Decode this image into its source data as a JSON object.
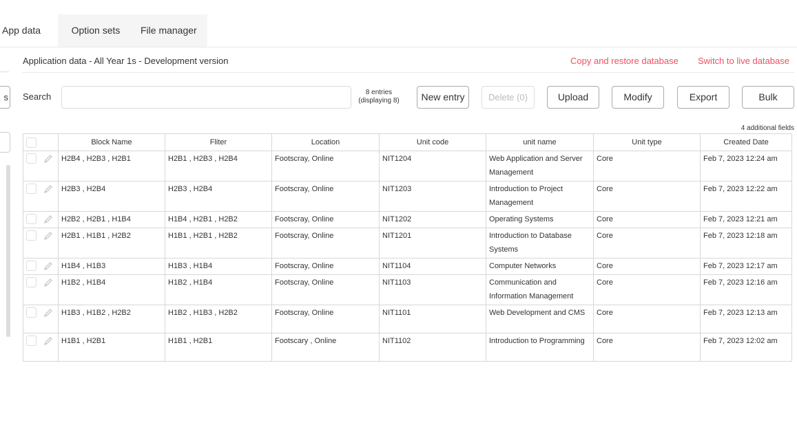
{
  "tabs": [
    {
      "label": "App data",
      "active": true
    },
    {
      "label": "Option sets",
      "active": false
    },
    {
      "label": "File manager",
      "active": false
    }
  ],
  "left_cut": {
    "button_fragment": "s"
  },
  "header": {
    "title": "Application data - All Year 1s - Development version",
    "copy_restore": "Copy and restore database",
    "switch_live": "Switch to live database"
  },
  "toolbar": {
    "search_label": "Search",
    "search_placeholder": "",
    "entries_line1": "8 entries",
    "entries_line2": "(displaying 8)",
    "new_entry": "New entry",
    "delete": "Delete (0)",
    "upload": "Upload",
    "modify": "Modify",
    "export": "Export",
    "bulk": "Bulk"
  },
  "additional_fields": "4 additional fields",
  "table": {
    "columns": [
      "Block Name",
      "Fliter",
      "Location",
      "Unit code",
      "unit name",
      "Unit type",
      "Created Date"
    ],
    "rows": [
      [
        "H2B4 , H2B3 , H2B1",
        "H2B1 , H2B3 , H2B4",
        "Footscray, Online",
        "NIT1204",
        "Web Application and Server Management",
        "Core",
        "Feb 7, 2023 12:24 am"
      ],
      [
        "H2B3 , H2B4",
        "H2B3 , H2B4",
        "Footscray, Online",
        "NIT1203",
        "Introduction to Project Management",
        "Core",
        "Feb 7, 2023 12:22 am"
      ],
      [
        "H2B2 , H2B1 , H1B4",
        "H1B4 , H2B1 , H2B2",
        "Footscray, Online",
        "NIT1202",
        "Operating Systems",
        "Core",
        "Feb 7, 2023 12:21 am"
      ],
      [
        "H2B1 , H1B1 , H2B2",
        "H1B1 , H2B1 , H2B2",
        "Footscray, Online",
        "NIT1201",
        "Introduction to Database Systems",
        "Core",
        "Feb 7, 2023 12:18 am"
      ],
      [
        "H1B4 , H1B3",
        "H1B3 , H1B4",
        "Footscray, Online",
        "NIT1104",
        "Computer Networks",
        "Core",
        "Feb 7, 2023 12:17 am"
      ],
      [
        "H1B2 , H1B4",
        "H1B2 , H1B4",
        "Footscray, Online",
        "NIT1103",
        "Communication and Information Management",
        "Core",
        "Feb 7, 2023 12:16 am"
      ],
      [
        "H1B3 , H1B2 , H2B2",
        "H1B2 , H1B3 , H2B2",
        "Footscray, Online",
        "NIT1101",
        "Web Development and CMS",
        "Core",
        "Feb 7, 2023 12:13 am"
      ],
      [
        "H1B1 , H2B1",
        "H1B1 , H2B1",
        "Footscary , Online",
        "NIT1102",
        "Introduction to Programming",
        "Core",
        "Feb 7, 2023 12:02 am"
      ]
    ]
  },
  "colors": {
    "accent_link": "#ef4f5f",
    "border": "#d7d7d7"
  },
  "icons": {
    "row_edit": "pencil-icon",
    "row_select": "checkbox"
  }
}
